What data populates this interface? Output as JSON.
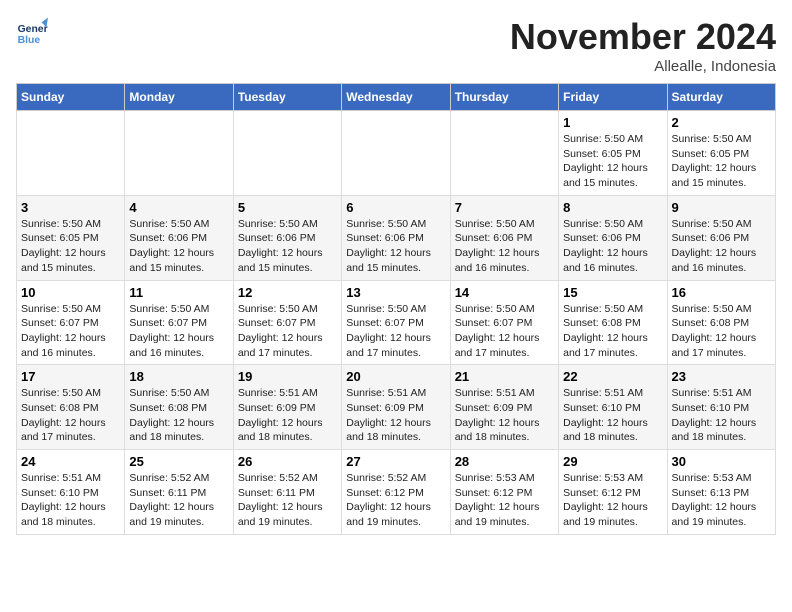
{
  "logo": {
    "line1": "General",
    "line2": "Blue"
  },
  "title": "November 2024",
  "location": "Allealle, Indonesia",
  "days_of_week": [
    "Sunday",
    "Monday",
    "Tuesday",
    "Wednesday",
    "Thursday",
    "Friday",
    "Saturday"
  ],
  "weeks": [
    [
      {
        "day": "",
        "info": ""
      },
      {
        "day": "",
        "info": ""
      },
      {
        "day": "",
        "info": ""
      },
      {
        "day": "",
        "info": ""
      },
      {
        "day": "",
        "info": ""
      },
      {
        "day": "1",
        "info": "Sunrise: 5:50 AM\nSunset: 6:05 PM\nDaylight: 12 hours\nand 15 minutes."
      },
      {
        "day": "2",
        "info": "Sunrise: 5:50 AM\nSunset: 6:05 PM\nDaylight: 12 hours\nand 15 minutes."
      }
    ],
    [
      {
        "day": "3",
        "info": "Sunrise: 5:50 AM\nSunset: 6:05 PM\nDaylight: 12 hours\nand 15 minutes."
      },
      {
        "day": "4",
        "info": "Sunrise: 5:50 AM\nSunset: 6:06 PM\nDaylight: 12 hours\nand 15 minutes."
      },
      {
        "day": "5",
        "info": "Sunrise: 5:50 AM\nSunset: 6:06 PM\nDaylight: 12 hours\nand 15 minutes."
      },
      {
        "day": "6",
        "info": "Sunrise: 5:50 AM\nSunset: 6:06 PM\nDaylight: 12 hours\nand 15 minutes."
      },
      {
        "day": "7",
        "info": "Sunrise: 5:50 AM\nSunset: 6:06 PM\nDaylight: 12 hours\nand 16 minutes."
      },
      {
        "day": "8",
        "info": "Sunrise: 5:50 AM\nSunset: 6:06 PM\nDaylight: 12 hours\nand 16 minutes."
      },
      {
        "day": "9",
        "info": "Sunrise: 5:50 AM\nSunset: 6:06 PM\nDaylight: 12 hours\nand 16 minutes."
      }
    ],
    [
      {
        "day": "10",
        "info": "Sunrise: 5:50 AM\nSunset: 6:07 PM\nDaylight: 12 hours\nand 16 minutes."
      },
      {
        "day": "11",
        "info": "Sunrise: 5:50 AM\nSunset: 6:07 PM\nDaylight: 12 hours\nand 16 minutes."
      },
      {
        "day": "12",
        "info": "Sunrise: 5:50 AM\nSunset: 6:07 PM\nDaylight: 12 hours\nand 17 minutes."
      },
      {
        "day": "13",
        "info": "Sunrise: 5:50 AM\nSunset: 6:07 PM\nDaylight: 12 hours\nand 17 minutes."
      },
      {
        "day": "14",
        "info": "Sunrise: 5:50 AM\nSunset: 6:07 PM\nDaylight: 12 hours\nand 17 minutes."
      },
      {
        "day": "15",
        "info": "Sunrise: 5:50 AM\nSunset: 6:08 PM\nDaylight: 12 hours\nand 17 minutes."
      },
      {
        "day": "16",
        "info": "Sunrise: 5:50 AM\nSunset: 6:08 PM\nDaylight: 12 hours\nand 17 minutes."
      }
    ],
    [
      {
        "day": "17",
        "info": "Sunrise: 5:50 AM\nSunset: 6:08 PM\nDaylight: 12 hours\nand 17 minutes."
      },
      {
        "day": "18",
        "info": "Sunrise: 5:50 AM\nSunset: 6:08 PM\nDaylight: 12 hours\nand 18 minutes."
      },
      {
        "day": "19",
        "info": "Sunrise: 5:51 AM\nSunset: 6:09 PM\nDaylight: 12 hours\nand 18 minutes."
      },
      {
        "day": "20",
        "info": "Sunrise: 5:51 AM\nSunset: 6:09 PM\nDaylight: 12 hours\nand 18 minutes."
      },
      {
        "day": "21",
        "info": "Sunrise: 5:51 AM\nSunset: 6:09 PM\nDaylight: 12 hours\nand 18 minutes."
      },
      {
        "day": "22",
        "info": "Sunrise: 5:51 AM\nSunset: 6:10 PM\nDaylight: 12 hours\nand 18 minutes."
      },
      {
        "day": "23",
        "info": "Sunrise: 5:51 AM\nSunset: 6:10 PM\nDaylight: 12 hours\nand 18 minutes."
      }
    ],
    [
      {
        "day": "24",
        "info": "Sunrise: 5:51 AM\nSunset: 6:10 PM\nDaylight: 12 hours\nand 18 minutes."
      },
      {
        "day": "25",
        "info": "Sunrise: 5:52 AM\nSunset: 6:11 PM\nDaylight: 12 hours\nand 19 minutes."
      },
      {
        "day": "26",
        "info": "Sunrise: 5:52 AM\nSunset: 6:11 PM\nDaylight: 12 hours\nand 19 minutes."
      },
      {
        "day": "27",
        "info": "Sunrise: 5:52 AM\nSunset: 6:12 PM\nDaylight: 12 hours\nand 19 minutes."
      },
      {
        "day": "28",
        "info": "Sunrise: 5:53 AM\nSunset: 6:12 PM\nDaylight: 12 hours\nand 19 minutes."
      },
      {
        "day": "29",
        "info": "Sunrise: 5:53 AM\nSunset: 6:12 PM\nDaylight: 12 hours\nand 19 minutes."
      },
      {
        "day": "30",
        "info": "Sunrise: 5:53 AM\nSunset: 6:13 PM\nDaylight: 12 hours\nand 19 minutes."
      }
    ]
  ]
}
